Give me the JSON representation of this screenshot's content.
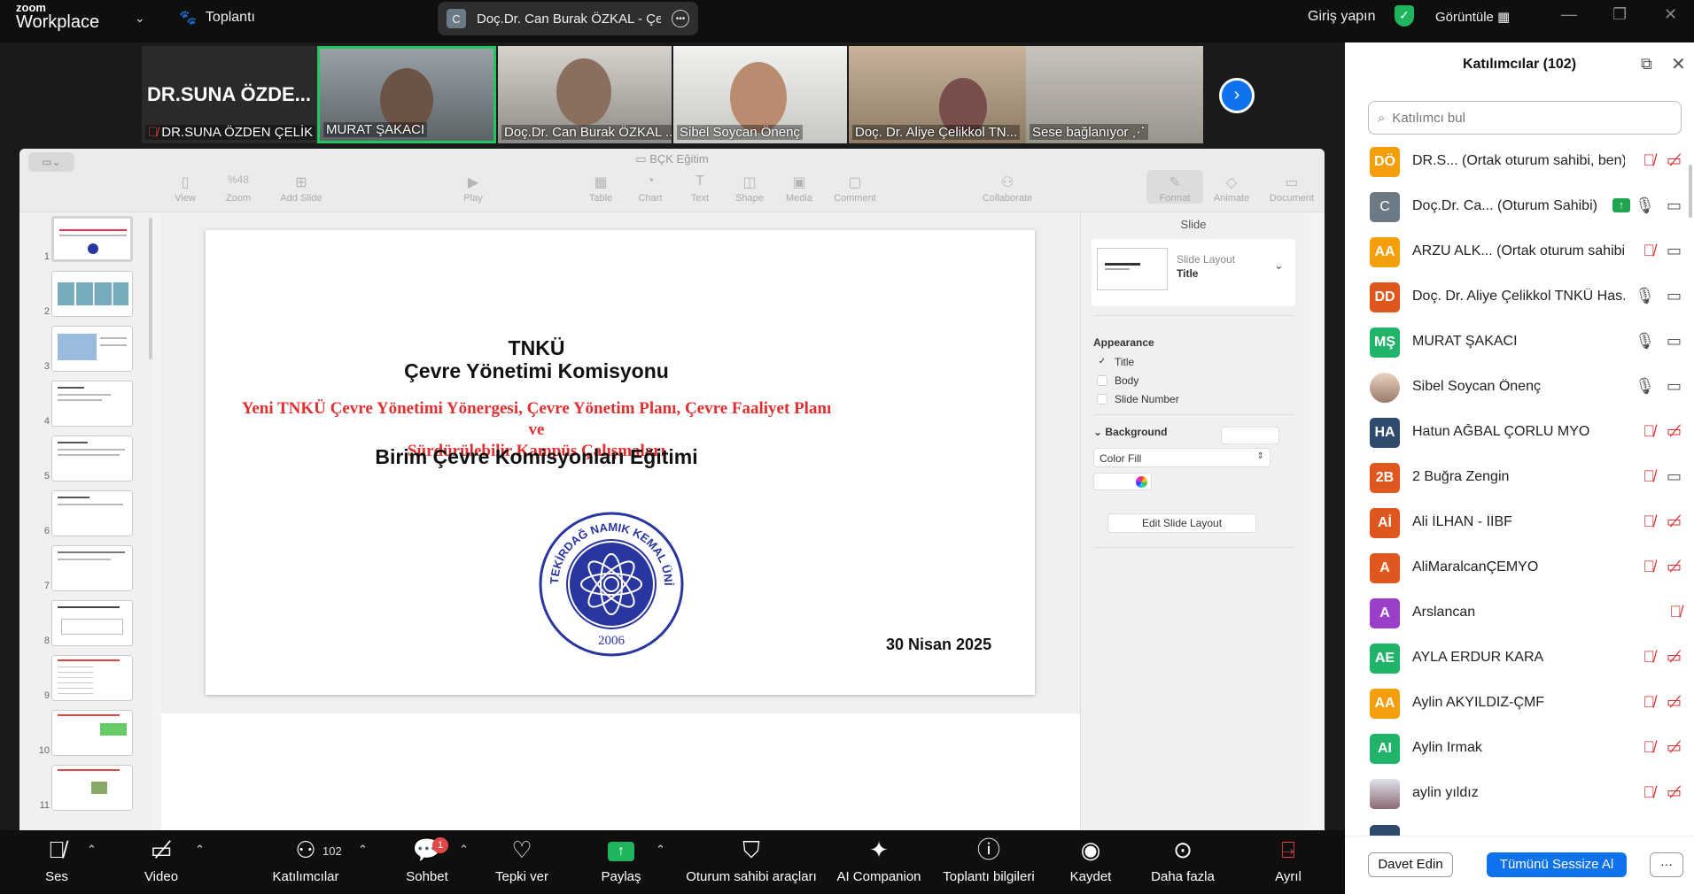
{
  "app": {
    "logo_top": "zoom",
    "logo_bottom": "Workplace",
    "meeting_label": "Toplantı",
    "window_title_badge": "C",
    "window_title": "Doç.Dr. Can Burak ÖZKAL - Çevre",
    "sign_in": "Giriş yapın",
    "view_label": "Görüntüle"
  },
  "video": {
    "tiles": [
      {
        "name": "DR.SUNA ÖZDEN ÇELİK",
        "big": "DR.SUNA ÖZDE..."
      },
      {
        "name": "MURAT ŞAKACI"
      },
      {
        "name": "Doç.Dr. Can Burak ÖZKAL ..."
      },
      {
        "name": "Sibel Soycan Önenç"
      },
      {
        "name": "Doç. Dr. Aliye Çelikkol TN..."
      },
      {
        "name": "Sese bağlanıyor"
      }
    ],
    "speaking_color": "#22c55e"
  },
  "keynote": {
    "doc_title": "BÇK Eğitim",
    "toolbar": {
      "view": "View",
      "zoom_value": "%48",
      "zoom": "Zoom",
      "add_slide": "Add Slide",
      "play": "Play",
      "table": "Table",
      "chart": "Chart",
      "text": "Text",
      "shape": "Shape",
      "media": "Media",
      "comment": "Comment",
      "collaborate": "Collaborate",
      "format": "Format",
      "animate": "Animate",
      "document": "Document"
    },
    "slide_numbers": [
      "1",
      "2",
      "3",
      "4",
      "5",
      "6",
      "7",
      "8",
      "9",
      "10",
      "11"
    ],
    "slide": {
      "line1": "TNKÜ",
      "line2": "Çevre Yönetimi Komisyonu",
      "red_line1": "Yeni TNKÜ Çevre Yönetimi Yönergesi, Çevre Yönetim Planı, Çevre Faaliyet Planı ve",
      "red_line2": "Sürdürülebilir Kampüs Çalışmaları",
      "line3": "Birim Çevre Komisyonları Eğitimi",
      "seal_text": "TEKİRDAĞ NAMIK KEMAL ÜNİVERSİTESİ",
      "seal_year": "2006",
      "date": "30 Nisan 2025"
    },
    "inspector": {
      "title": "Slide",
      "layout_label": "Slide Layout",
      "layout_value": "Title",
      "appearance": "Appearance",
      "opt_title": "Title",
      "opt_body": "Body",
      "opt_slide_number": "Slide Number",
      "background": "Background",
      "fill": "Color Fill",
      "edit_layout": "Edit Slide Layout"
    }
  },
  "panel": {
    "title": "Katılımcılar (102)",
    "search_placeholder": "Katılımcı bul",
    "participants": [
      {
        "initials": "DÖ",
        "name": "DR.S...  (Ortak oturum sahibi, ben)",
        "color": "#f59e0b"
      },
      {
        "initials": "C",
        "name": "Doç.Dr. Ca...  (Oturum Sahibi)",
        "color": "#6b7a84"
      },
      {
        "initials": "AA",
        "name": "ARZU ALK...  (Ortak oturum sahibi)",
        "color": "#f59e0b"
      },
      {
        "initials": "DD",
        "name": "Doç. Dr. Aliye Çelikkol TNKÜ Has...",
        "color": "#e0571d"
      },
      {
        "initials": "MŞ",
        "name": "MURAT ŞAKACI",
        "color": "#22b36a"
      },
      {
        "initials": "",
        "name": "Sibel Soycan Önenç",
        "color": "#c9a48e"
      },
      {
        "initials": "HA",
        "name": " Hatun AĞBAL ÇORLU MYO",
        "color": "#2f4a6d"
      },
      {
        "initials": "2B",
        "name": "2 Buğra Zengin",
        "color": "#e0571d"
      },
      {
        "initials": "Aİ",
        "name": "Ali İLHAN - İİBF",
        "color": "#e0571d"
      },
      {
        "initials": "A",
        "name": "AliMaralcanÇEMYO",
        "color": "#e0571d"
      },
      {
        "initials": "A",
        "name": "Arslancan",
        "color": "#9b3fc8"
      },
      {
        "initials": "AE",
        "name": "AYLA ERDUR KARA",
        "color": "#22b36a"
      },
      {
        "initials": "AA",
        "name": "Aylin AKYILDIZ-ÇMF",
        "color": "#f59e0b"
      },
      {
        "initials": "AI",
        "name": "Aylin Irmak",
        "color": "#22b36a"
      },
      {
        "initials": "",
        "name": "aylin yıldız",
        "color": "#aab3c7"
      }
    ],
    "invite": "Davet Edin",
    "mute_all": "Tümünü Sessize Al",
    "more": "···"
  },
  "toolbar": {
    "audio": "Ses",
    "video": "Video",
    "participants": "Katılımcılar",
    "participants_count": "102",
    "chat": "Sohbet",
    "chat_badge": "1",
    "react": "Tepki ver",
    "share": "Paylaş",
    "host_tools": "Oturum sahibi araçları",
    "ai": "AI Companion",
    "info": "Toplantı bilgileri",
    "record": "Kaydet",
    "more": "Daha fazla",
    "leave": "Ayrıl"
  }
}
